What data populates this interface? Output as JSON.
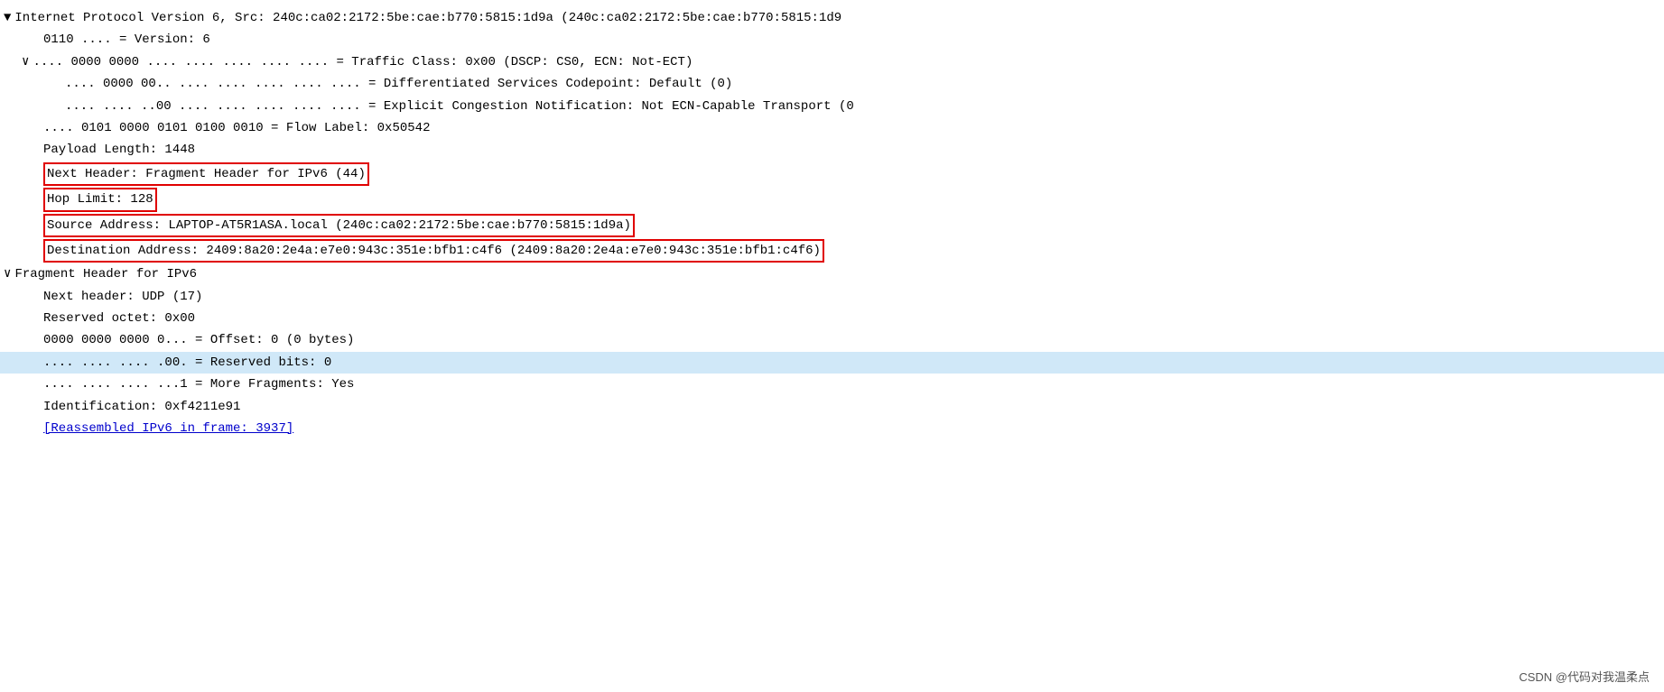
{
  "tree": {
    "rows": [
      {
        "id": "ipv6-header",
        "indent": 0,
        "toggle": "▼",
        "text": " Internet Protocol Version 6, Src: 240c:ca02:2172:5be:cae:b770:5815:1d9a (240c:ca02:2172:5be:cae:b770:5815:1d9",
        "highlight": false,
        "boxed": false,
        "link": false
      },
      {
        "id": "version",
        "indent": 2,
        "toggle": "",
        "text": "0110 .... = Version: 6",
        "highlight": false,
        "boxed": false,
        "link": false
      },
      {
        "id": "traffic-class",
        "indent": 2,
        "toggle": "∨",
        "text": " .... 0000 0000 .... .... .... .... .... = Traffic Class: 0x00 (DSCP: CS0, ECN: Not-ECT)",
        "highlight": false,
        "boxed": false,
        "link": false
      },
      {
        "id": "dscp",
        "indent": 3,
        "toggle": "",
        "text": ".... 0000 00.. .... .... .... .... .... = Differentiated Services Codepoint: Default (0)",
        "highlight": false,
        "boxed": false,
        "link": false
      },
      {
        "id": "ecn",
        "indent": 3,
        "toggle": "",
        "text": ".... .... ..00 .... .... .... .... .... = Explicit Congestion Notification: Not ECN-Capable Transport (0",
        "highlight": false,
        "boxed": false,
        "link": false
      },
      {
        "id": "flow-label",
        "indent": 2,
        "toggle": "",
        "text": ".... 0101 0000 0101 0100 0010 = Flow Label: 0x50542",
        "highlight": false,
        "boxed": false,
        "link": false
      },
      {
        "id": "payload-length",
        "indent": 2,
        "toggle": "",
        "text": "Payload Length: 1448",
        "highlight": false,
        "boxed": false,
        "link": false
      },
      {
        "id": "next-header",
        "indent": 2,
        "toggle": "",
        "text": "Next Header: Fragment Header for IPv6 (44)",
        "highlight": false,
        "boxed": true,
        "link": false
      },
      {
        "id": "hop-limit",
        "indent": 2,
        "toggle": "",
        "text": "Hop Limit: 128",
        "highlight": false,
        "boxed": true,
        "link": false
      },
      {
        "id": "src-addr",
        "indent": 2,
        "toggle": "",
        "text": "Source Address: LAPTOP-AT5R1ASA.local (240c:ca02:2172:5be:cae:b770:5815:1d9a)",
        "highlight": false,
        "boxed": true,
        "link": false
      },
      {
        "id": "dst-addr",
        "indent": 2,
        "toggle": "",
        "text": "Destination Address: 2409:8a20:2e4a:e7e0:943c:351e:bfb1:c4f6 (2409:8a20:2e4a:e7e0:943c:351e:bfb1:c4f6)",
        "highlight": false,
        "boxed": true,
        "link": false
      },
      {
        "id": "frag-header",
        "indent": 0,
        "toggle": "∨",
        "text": " Fragment Header for IPv6",
        "highlight": false,
        "boxed": false,
        "link": false
      },
      {
        "id": "next-header-udp",
        "indent": 2,
        "toggle": "",
        "text": "Next header: UDP (17)",
        "highlight": false,
        "boxed": false,
        "link": false
      },
      {
        "id": "reserved-octet",
        "indent": 2,
        "toggle": "",
        "text": "Reserved octet: 0x00",
        "highlight": false,
        "boxed": false,
        "link": false
      },
      {
        "id": "offset",
        "indent": 2,
        "toggle": "",
        "text": "0000 0000 0000 0... = Offset: 0 (0 bytes)",
        "highlight": false,
        "boxed": false,
        "link": false
      },
      {
        "id": "reserved-bits",
        "indent": 2,
        "toggle": "",
        "text": ".... .... .... .00. = Reserved bits: 0",
        "highlight": true,
        "boxed": false,
        "link": false
      },
      {
        "id": "more-fragments",
        "indent": 2,
        "toggle": "",
        "text": ".... .... .... ...1 = More Fragments: Yes",
        "highlight": false,
        "boxed": false,
        "link": false
      },
      {
        "id": "identification",
        "indent": 2,
        "toggle": "",
        "text": "Identification: 0xf4211e91",
        "highlight": false,
        "boxed": false,
        "link": false
      },
      {
        "id": "reassembled-link",
        "indent": 2,
        "toggle": "",
        "text": "[Reassembled IPv6 in frame: 3937]",
        "highlight": false,
        "boxed": false,
        "link": true
      }
    ],
    "watermark": "CSDN @代码对我温柔点"
  }
}
